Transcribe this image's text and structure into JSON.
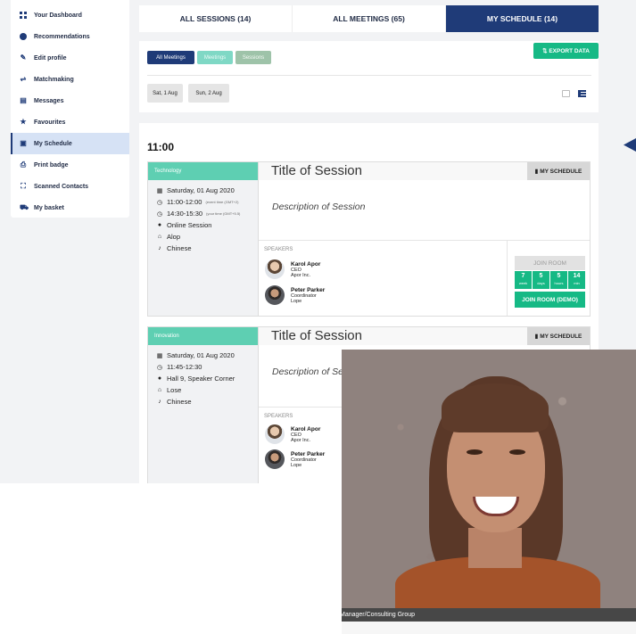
{
  "sidebar": {
    "items": [
      {
        "label": "Your Dashboard",
        "icon": "dashboard-icon"
      },
      {
        "label": "Recommendations",
        "icon": "globe-icon"
      },
      {
        "label": "Edit profile",
        "icon": "pencil-icon"
      },
      {
        "label": "Matchmaking",
        "icon": "handshake-icon"
      },
      {
        "label": "Messages",
        "icon": "message-icon"
      },
      {
        "label": "Favourites",
        "icon": "star-icon"
      },
      {
        "label": "My Schedule",
        "icon": "calendar-icon",
        "active": true
      },
      {
        "label": "Print badge",
        "icon": "printer-icon"
      },
      {
        "label": "Scanned Contacts",
        "icon": "scan-icon"
      },
      {
        "label": "My basket",
        "icon": "cart-icon"
      }
    ]
  },
  "tabs": [
    {
      "label": "ALL SESSIONS (14)"
    },
    {
      "label": "ALL MEETINGS (65)"
    },
    {
      "label": "MY SCHEDULE (14)",
      "active": true
    }
  ],
  "filters": {
    "all_meetings": "All Meetings",
    "meetings": "Meetings",
    "sessions": "Sessions",
    "export": "⇅ EXPORT DATA",
    "days": [
      "Sat, 1 Aug",
      "Sun, 2 Aug"
    ]
  },
  "schedule": {
    "time": "11:00",
    "cards": [
      {
        "category": "Technology",
        "title": "Title of Session",
        "my_schedule": "MY SCHEDULE",
        "description": "Description of Session",
        "date": "Saturday, 01 Aug 2020",
        "time_event": "11:00-12:00",
        "time_event_note": "(event time (GMT+2)",
        "time_local": "14:30-15:30",
        "time_local_note": "(your time (GMT+5.5)",
        "location": "Online Session",
        "company": "Alop",
        "language": "Chinese",
        "speakers_label": "SPEAKERS",
        "speakers": [
          {
            "name": "Karol Apor",
            "role": "CEO",
            "org": "Apor Inc."
          },
          {
            "name": "Peter Parker",
            "role": "Coordinator",
            "org": "Lope"
          }
        ],
        "join_room": "JOIN ROOM",
        "countdown": [
          {
            "value": "7",
            "unit": "week"
          },
          {
            "value": "5",
            "unit": "days"
          },
          {
            "value": "5",
            "unit": "hours"
          },
          {
            "value": "14",
            "unit": "min"
          }
        ],
        "join_demo": "JOIN ROOM (DEMO)"
      },
      {
        "category": "Innovation",
        "title": "Title of Session",
        "my_schedule": "MY SCHEDULE",
        "description": "Description of Session",
        "date": "Saturday, 01 Aug 2020",
        "time_event": "11:45-12:30",
        "location": "Hall 9, Speaker Corner",
        "company": "Lose",
        "language": "Chinese",
        "speakers_label": "SPEAKERS",
        "speakers": [
          {
            "name": "Karol Apor",
            "role": "CEO",
            "org": "Apor Inc."
          },
          {
            "name": "Peter Parker",
            "role": "Coordinator",
            "org": "Lope"
          }
        ]
      }
    ]
  },
  "photo": {
    "caption": "Manager/Consulting Group"
  }
}
